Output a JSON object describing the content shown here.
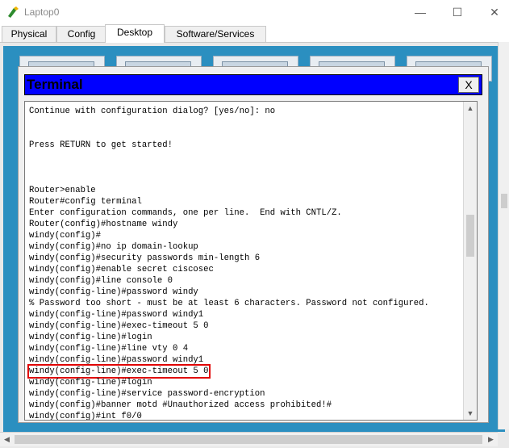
{
  "window": {
    "title": "Laptop0",
    "minimize": "—",
    "maximize": "☐",
    "close": "✕"
  },
  "tabs": [
    {
      "label": "Physical"
    },
    {
      "label": "Config"
    },
    {
      "label": "Desktop",
      "active": true
    },
    {
      "label": "Software/Services"
    }
  ],
  "terminal": {
    "title": "Terminal",
    "close_label": "X",
    "lines": [
      "Continue with configuration dialog? [yes/no]: no",
      "",
      "",
      "Press RETURN to get started!",
      "",
      "",
      "",
      "Router>enable",
      "Router#config terminal",
      "Enter configuration commands, one per line.  End with CNTL/Z.",
      "Router(config)#hostname windy",
      "windy(config)#",
      "windy(config)#no ip domain-lookup",
      "windy(config)#security passwords min-length 6",
      "windy(config)#enable secret ciscosec",
      "windy(config)#line console 0",
      "windy(config-line)#password windy",
      "% Password too short - must be at least 6 characters. Password not configured.",
      "windy(config-line)#password windy1",
      "windy(config-line)#exec-timeout 5 0",
      "windy(config-line)#login",
      "windy(config-line)#line vty 0 4",
      "windy(config-line)#password windy1",
      "windy(config-line)#exec-timeout 5 0",
      "windy(config-line)#login",
      "windy(config-line)#service password-encryption",
      "windy(config)#banner motd #Unauthorized access prohibited!#",
      "windy(config)#int f0/0"
    ],
    "highlighted_line_index": 23
  },
  "colors": {
    "terminal_header": "#0000ff",
    "desktop_background": "#2b8fc0",
    "highlight_box": "#e00000"
  },
  "icons": {
    "app": "packet-tracer-laptop-icon",
    "scroll_up": "▲",
    "scroll_down": "▼",
    "scroll_left": "◀",
    "scroll_right": "▶"
  }
}
